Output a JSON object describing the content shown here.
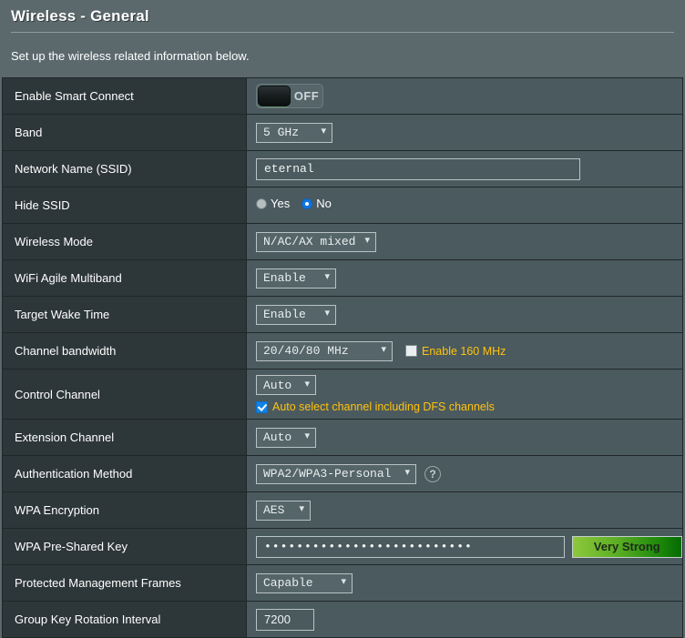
{
  "header": {
    "title": "Wireless - General",
    "subtitle": "Set up the wireless related information below."
  },
  "colors": {
    "page_bg": "#5b696d",
    "label_cell_bg": "#2d3639",
    "value_cell_bg": "#4b5a5e",
    "grid_line": "#1f2729",
    "accent_yellow": "#ffc20e",
    "accent_blue": "#1183e8",
    "strength_green_light": "#8ec83c",
    "strength_green_dark": "#056b00"
  },
  "rows": {
    "smart_connect": {
      "label": "Enable Smart Connect",
      "toggle_state": "OFF"
    },
    "band": {
      "label": "Band",
      "value": "5 GHz",
      "chevron": "chevron-down-icon"
    },
    "ssid": {
      "label": "Network Name (SSID)",
      "value": "eternal",
      "placeholder": ""
    },
    "hide_ssid": {
      "label": "Hide SSID",
      "options": [
        {
          "label": "Yes",
          "selected": false
        },
        {
          "label": "No",
          "selected": true
        }
      ]
    },
    "wireless_mode": {
      "label": "Wireless Mode",
      "value": "N/AC/AX mixed"
    },
    "agile_multiband": {
      "label": "WiFi Agile Multiband",
      "value": "Enable"
    },
    "target_wake_time": {
      "label": "Target Wake Time",
      "value": "Enable"
    },
    "channel_bandwidth": {
      "label": "Channel bandwidth",
      "value": "20/40/80 MHz",
      "checkbox_label": "Enable 160 MHz",
      "checkbox_checked": false
    },
    "control_channel": {
      "label": "Control Channel",
      "value": "Auto",
      "checkbox_label": "Auto select channel including DFS channels",
      "checkbox_checked": true
    },
    "extension_channel": {
      "label": "Extension Channel",
      "value": "Auto"
    },
    "auth_method": {
      "label": "Authentication Method",
      "value": "WPA2/WPA3-Personal",
      "help": "?"
    },
    "wpa_encryption": {
      "label": "WPA Encryption",
      "value": "AES"
    },
    "wpa_psk": {
      "label": "WPA Pre-Shared Key",
      "value": "••••••••••••••••••••••••••",
      "strength": "Very Strong"
    },
    "pmf": {
      "label": "Protected Management Frames",
      "value": "Capable"
    },
    "group_key_rotation": {
      "label": "Group Key Rotation Interval",
      "value": "7200"
    }
  }
}
